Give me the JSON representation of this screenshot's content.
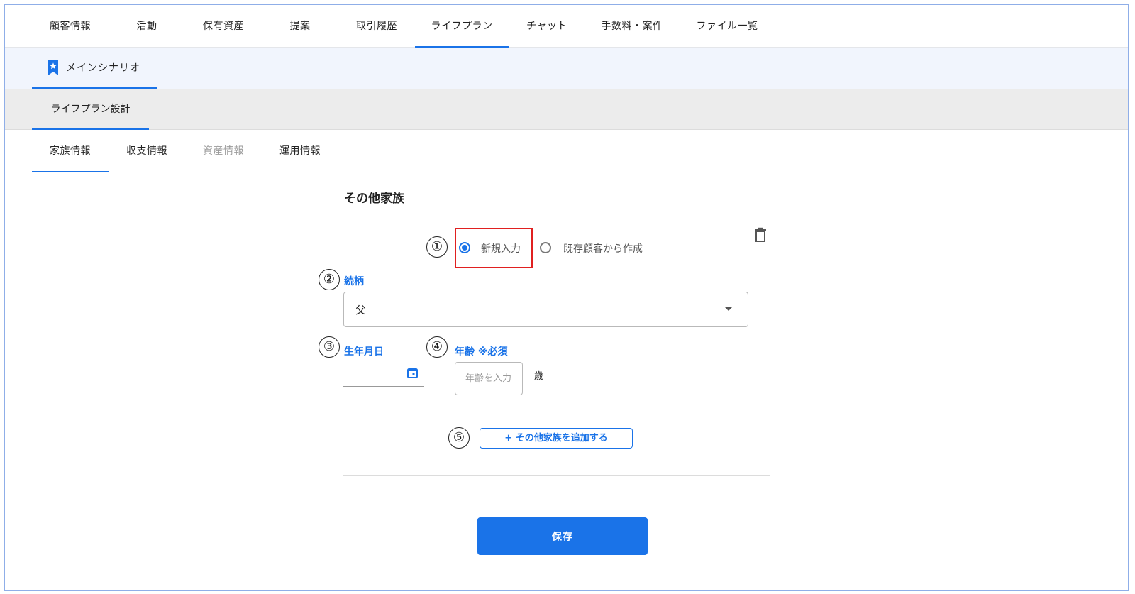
{
  "top_tabs": [
    {
      "label": "顧客情報"
    },
    {
      "label": "活動"
    },
    {
      "label": "保有資産"
    },
    {
      "label": "提案"
    },
    {
      "label": "取引履歴"
    },
    {
      "label": "ライフプラン",
      "active": true
    },
    {
      "label": "チャット"
    },
    {
      "label": "手数料・案件"
    },
    {
      "label": "ファイル一覧"
    }
  ],
  "scenario": {
    "label": "メインシナリオ",
    "icon": "bookmark-star-icon"
  },
  "design": {
    "label": "ライフプラン設計"
  },
  "sub_tabs": [
    {
      "label": "家族情報",
      "active": true
    },
    {
      "label": "収支情報"
    },
    {
      "label": "資産情報",
      "disabled": true
    },
    {
      "label": "運用情報"
    }
  ],
  "form": {
    "section_title": "その他家族",
    "markers": [
      "①",
      "②",
      "③",
      "④",
      "⑤"
    ],
    "radio_new": "新規入力",
    "radio_existing": "既存顧客から作成",
    "relation_label": "続柄",
    "relation_value": "父",
    "birthdate_label": "生年月日",
    "age_label": "年齢 ※必須",
    "age_placeholder": "年齢を入力",
    "age_unit": "歳",
    "add_button": "+ その他家族を追加する",
    "save_button": "保存"
  },
  "colors": {
    "accent": "#1a73e8",
    "highlight": "#e02020"
  }
}
